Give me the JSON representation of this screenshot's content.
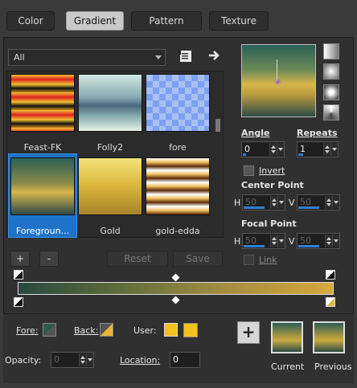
{
  "tabs": [
    {
      "label": "Color"
    },
    {
      "label": "Gradient"
    },
    {
      "label": "Pattern"
    },
    {
      "label": "Texture"
    }
  ],
  "category_dropdown": {
    "value": "All"
  },
  "gradients": [
    {
      "name": "Feast-FK"
    },
    {
      "name": "Folly2"
    },
    {
      "name": "fore"
    },
    {
      "name": "Foregroun..."
    },
    {
      "name": "Gold"
    },
    {
      "name": "gold-edda"
    }
  ],
  "gradient_buttons": {
    "add": "+",
    "remove": "-",
    "reset": "Reset",
    "save": "Save"
  },
  "angle": {
    "label": "Angle",
    "value": "0"
  },
  "repeats": {
    "label": "Repeats",
    "value": "1"
  },
  "invert": {
    "label": "Invert",
    "checked": false
  },
  "center_point": {
    "label": "Center Point",
    "h_label": "H",
    "h_value": "50",
    "v_label": "V",
    "v_value": "50"
  },
  "focal_point": {
    "label": "Focal Point",
    "h_label": "H",
    "h_value": "50",
    "v_label": "V",
    "v_value": "50"
  },
  "link": {
    "label": "Link",
    "checked": false
  },
  "stops": {
    "fore_label": "Fore:",
    "back_label": "Back:",
    "user_label": "User:",
    "opacity_label": "Opacity:",
    "opacity_value": "0",
    "location_label": "Location:",
    "location_value": "0"
  },
  "swatches": {
    "current_label": "Current",
    "previous_label": "Previous",
    "add": "+"
  },
  "colors": {
    "user_gold": "#f2c21c",
    "fore": "#2f5a4e"
  }
}
